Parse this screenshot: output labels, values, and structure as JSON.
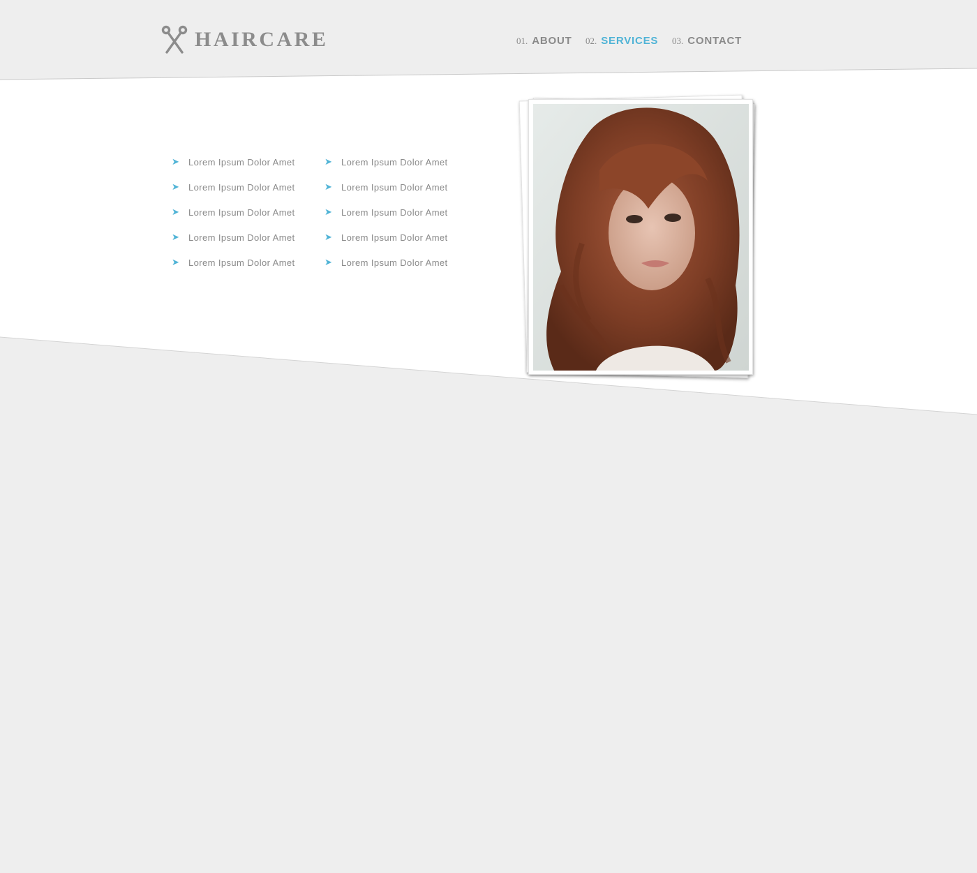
{
  "brand": {
    "name": "HAIRCARE",
    "icon": "scissors-icon"
  },
  "nav": [
    {
      "num": "01.",
      "label": "ABOUT",
      "active": false
    },
    {
      "num": "02.",
      "label": "SERVICES",
      "active": true
    },
    {
      "num": "03.",
      "label": "CONTACT",
      "active": false
    }
  ],
  "services": {
    "bullet_icon": "arrow-right-icon",
    "column_1": [
      "Lorem Ipsum Dolor Amet",
      "Lorem Ipsum Dolor Amet",
      "Lorem Ipsum Dolor Amet",
      "Lorem Ipsum Dolor Amet",
      "Lorem Ipsum Dolor Amet"
    ],
    "column_2": [
      "Lorem Ipsum Dolor Amet",
      "Lorem Ipsum Dolor Amet",
      "Lorem Ipsum Dolor Amet",
      "Lorem Ipsum Dolor Amet",
      "Lorem Ipsum Dolor Amet"
    ]
  },
  "colors": {
    "accent": "#4fb3d6",
    "text": "#8a8a8a",
    "background": "#eeeeee",
    "panel": "#ffffff"
  }
}
